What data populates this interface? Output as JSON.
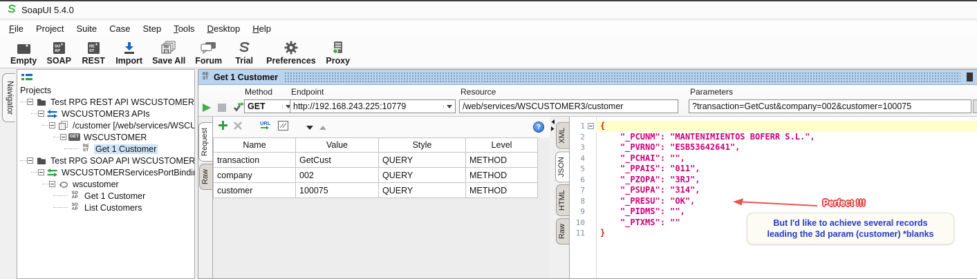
{
  "window": {
    "title": "SoapUI 5.4.0"
  },
  "menu": {
    "items": [
      {
        "label": "File",
        "underline": 0
      },
      {
        "label": "Project",
        "underline": null
      },
      {
        "label": "Suite",
        "underline": null
      },
      {
        "label": "Case",
        "underline": null
      },
      {
        "label": "Step",
        "underline": null
      },
      {
        "label": "Tools",
        "underline": 0
      },
      {
        "label": "Desktop",
        "underline": 0
      },
      {
        "label": "Help",
        "underline": 0
      }
    ]
  },
  "toolbar": {
    "buttons": [
      {
        "id": "empty",
        "label": "Empty",
        "icon": "empty-project-icon"
      },
      {
        "id": "soap",
        "label": "SOAP",
        "icon": "soap-project-icon"
      },
      {
        "id": "rest",
        "label": "REST",
        "icon": "rest-project-icon"
      },
      {
        "id": "import",
        "label": "Import",
        "icon": "import-icon"
      },
      {
        "id": "save-all",
        "label": "Save All",
        "icon": "save-all-icon"
      },
      {
        "id": "forum",
        "label": "Forum",
        "icon": "forum-icon"
      },
      {
        "id": "trial",
        "label": "Trial",
        "icon": "trial-icon"
      },
      {
        "id": "preferences",
        "label": "Preferences",
        "icon": "preferences-gear-icon"
      },
      {
        "id": "proxy",
        "label": "Proxy",
        "icon": "proxy-icon"
      }
    ]
  },
  "navigator": {
    "tab_label": "Navigator",
    "root_label": "Projects",
    "tree": [
      {
        "label": "Test RPG REST API WSCUSTOMER",
        "icon": "folder-icon",
        "level": 0,
        "expander": true
      },
      {
        "label": "WSCUSTOMER3 APIs",
        "icon": "rest-service-icon",
        "level": 1,
        "expander": true
      },
      {
        "label": "/customer [/web/services/WSCU",
        "icon": "rest-resource-icon",
        "level": 2,
        "expander": true
      },
      {
        "label": "WSCUSTOMER",
        "icon": "get-method-icon",
        "level": 3,
        "expander": true
      },
      {
        "label": "Get 1 Customer",
        "icon": "rest-request-icon",
        "level": 4,
        "selected": true
      },
      {
        "label": "Test RPG SOAP API WSCUSTOMER",
        "icon": "folder-icon",
        "level": 0,
        "expander": true
      },
      {
        "label": "WSCUSTOMERServicesPortBinding",
        "icon": "soap-binding-icon",
        "level": 1,
        "expander": true
      },
      {
        "label": "wscustomer",
        "icon": "soap-operation-icon",
        "level": 2,
        "expander": true
      },
      {
        "label": "Get 1 Customer",
        "icon": "soap-request-icon",
        "level": 3
      },
      {
        "label": "List Customers",
        "icon": "soap-request-icon",
        "level": 3
      }
    ]
  },
  "request_window": {
    "title": "Get 1 Customer",
    "method": {
      "label": "Method",
      "value": "GET"
    },
    "endpoint": {
      "label": "Endpoint",
      "value": "http://192.168.243.225:10779"
    },
    "resource": {
      "label": "Resource",
      "value": "/web/services/WSCUSTOMER3/customer"
    },
    "parameters": {
      "label": "Parameters",
      "value": "?transaction=GetCust&company=002&customer=100075"
    },
    "left_tabs": [
      "Request",
      "Raw"
    ],
    "left_selected": "Request",
    "param_table": {
      "columns": [
        "Name",
        "Value",
        "Style",
        "Level"
      ],
      "rows": [
        [
          "transaction",
          "GetCust",
          "QUERY",
          "METHOD"
        ],
        [
          "company",
          "002",
          "QUERY",
          "METHOD"
        ],
        [
          "customer",
          "100075",
          "QUERY",
          "METHOD"
        ]
      ]
    },
    "right_tabs": [
      "XML",
      "JSON",
      "HTML",
      "Raw"
    ],
    "right_selected": "JSON",
    "response": {
      "lines": [
        {
          "n": 1,
          "text": "{",
          "fold": true,
          "highlight": true,
          "brace": true
        },
        {
          "n": 2,
          "text": "    \"_PCUNM\": \"MANTENIMIENTOS BOFERR S.L.\","
        },
        {
          "n": 3,
          "text": "    \"_PVRNO\": \"ESB53642641\","
        },
        {
          "n": 4,
          "text": "    \"_PCHAI\": \"\","
        },
        {
          "n": 5,
          "text": "    \"_PPAIS\": \"011\","
        },
        {
          "n": 6,
          "text": "    \"_PZOPA\": \"3RJ\","
        },
        {
          "n": 7,
          "text": "    \"_PSUPA\": \"314\","
        },
        {
          "n": 8,
          "text": "    \"_PRESU\": \"OK\","
        },
        {
          "n": 9,
          "text": "    \"_PIDMS\": \"\","
        },
        {
          "n": 10,
          "text": "    \"_PTXMS\": \"\""
        },
        {
          "n": 11,
          "text": "}",
          "brace": true
        }
      ]
    }
  },
  "annotations": {
    "perfect_label": "Perfect !!!",
    "note_line1": "But I'd like to achieve several records",
    "note_line2": "leading the 3d param (customer) *blanks"
  },
  "colors": {
    "titlebar_blue": "#b9d4ee",
    "selection_blue": "#cde3f7",
    "highlight_yellow": "#ffffcc",
    "json_text_pink": "#cc0077",
    "brace_red": "#cc2200",
    "note_blue": "#2438c8",
    "arrow_red": "#e34040",
    "run_green": "#3fae49",
    "soapui_green": "#3fae49"
  }
}
